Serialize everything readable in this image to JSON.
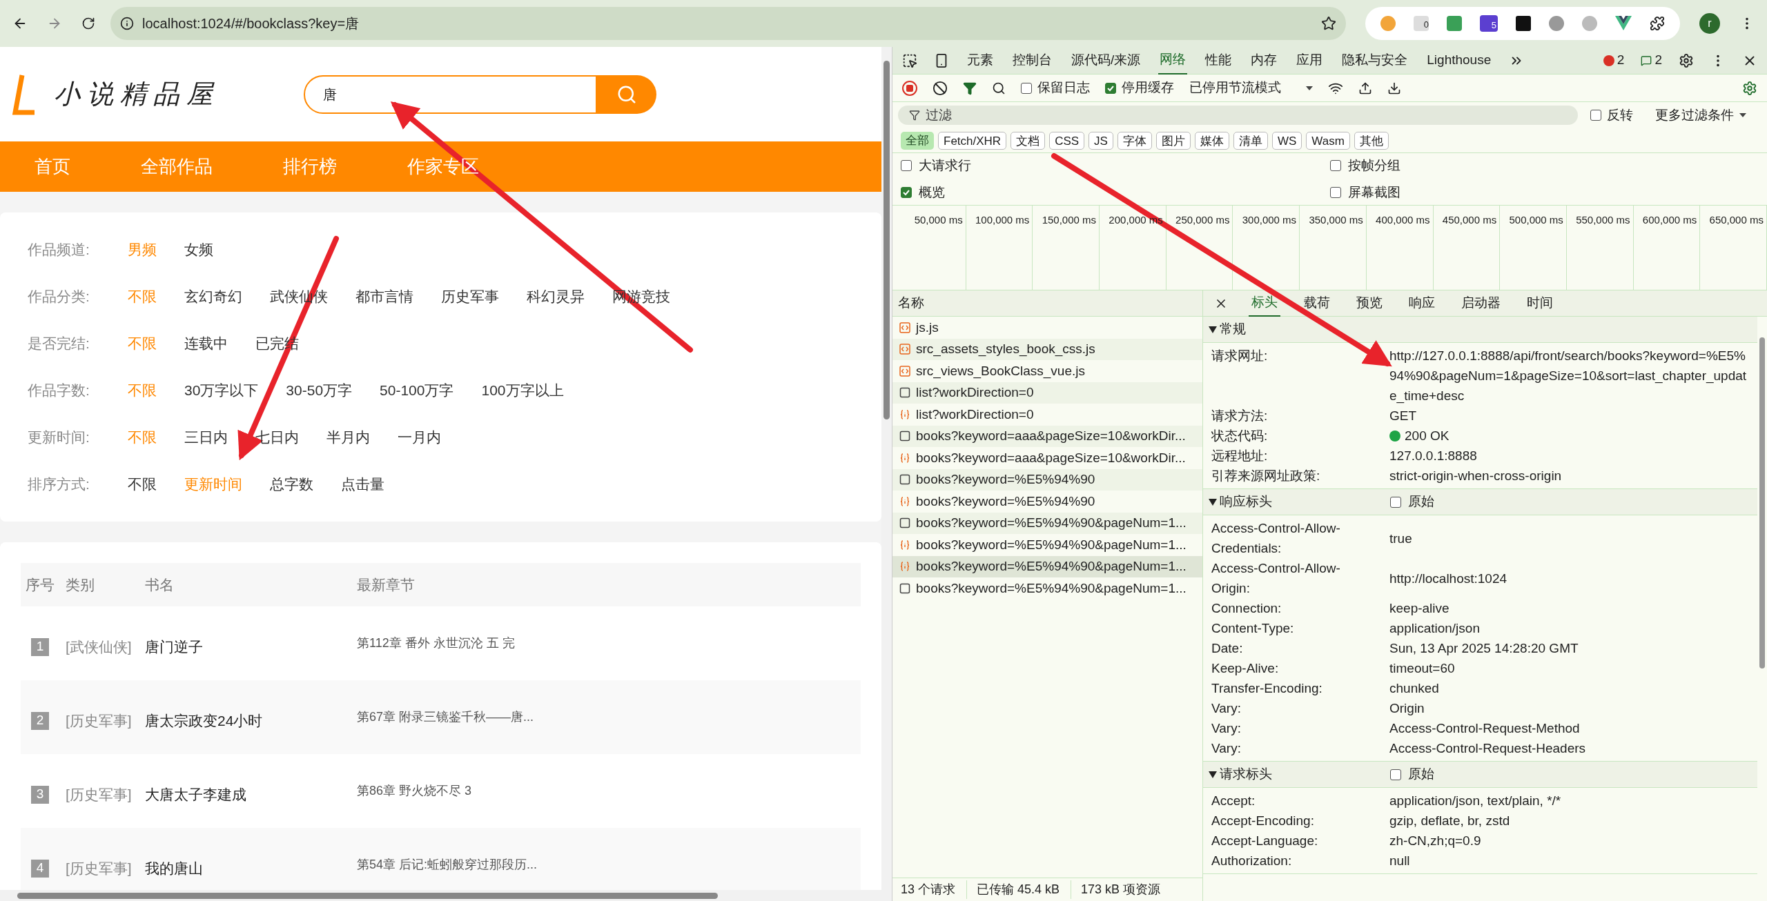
{
  "browser": {
    "url": "localhost:1024/#/bookclass?key=唐",
    "badges": [
      "0",
      "5"
    ],
    "avatar": "r"
  },
  "site": {
    "logo": "小说精品屋",
    "search": {
      "value": "唐"
    },
    "nav": [
      "首页",
      "全部作品",
      "排行榜",
      "作家专区"
    ],
    "filters": [
      {
        "label": "作品频道:",
        "options": [
          {
            "text": "男频",
            "selected": true
          },
          {
            "text": "女频",
            "selected": false
          }
        ]
      },
      {
        "label": "作品分类:",
        "options": [
          {
            "text": "不限",
            "selected": true
          },
          {
            "text": "玄幻奇幻",
            "selected": false
          },
          {
            "text": "武侠仙侠",
            "selected": false
          },
          {
            "text": "都市言情",
            "selected": false
          },
          {
            "text": "历史军事",
            "selected": false
          },
          {
            "text": "科幻灵异",
            "selected": false
          },
          {
            "text": "网游竞技",
            "selected": false
          }
        ]
      },
      {
        "label": "是否完结:",
        "options": [
          {
            "text": "不限",
            "selected": true
          },
          {
            "text": "连载中",
            "selected": false
          },
          {
            "text": "已完结",
            "selected": false
          }
        ]
      },
      {
        "label": "作品字数:",
        "options": [
          {
            "text": "不限",
            "selected": true
          },
          {
            "text": "30万字以下",
            "selected": false
          },
          {
            "text": "30-50万字",
            "selected": false
          },
          {
            "text": "50-100万字",
            "selected": false
          },
          {
            "text": "100万字以上",
            "selected": false
          }
        ]
      },
      {
        "label": "更新时间:",
        "options": [
          {
            "text": "不限",
            "selected": true
          },
          {
            "text": "三日内",
            "selected": false
          },
          {
            "text": "七日内",
            "selected": false
          },
          {
            "text": "半月内",
            "selected": false
          },
          {
            "text": "一月内",
            "selected": false
          }
        ]
      },
      {
        "label": "排序方式:",
        "options": [
          {
            "text": "不限",
            "selected": false
          },
          {
            "text": "更新时间",
            "selected": true
          },
          {
            "text": "总字数",
            "selected": false
          },
          {
            "text": "点击量",
            "selected": false
          }
        ]
      }
    ],
    "table": {
      "columns": [
        "序号",
        "类别",
        "书名",
        "最新章节"
      ],
      "rows": [
        {
          "rank": "1",
          "category": "[武侠仙侠]",
          "title": "唐门逆子",
          "chapter": "第112章 番外 永世沉沦 五 完"
        },
        {
          "rank": "2",
          "category": "[历史军事]",
          "title": "唐太宗政变24小时",
          "chapter": "第67章 附录三镜鉴千秋——唐..."
        },
        {
          "rank": "3",
          "category": "[历史军事]",
          "title": "大唐太子李建成",
          "chapter": "第86章 野火烧不尽 3"
        },
        {
          "rank": "4",
          "category": "[历史军事]",
          "title": "我的唐山",
          "chapter": "第54章 后记:蚯蚓般穿过那段历..."
        }
      ]
    }
  },
  "devtools": {
    "tabs": [
      {
        "label": "元素",
        "selected": false
      },
      {
        "label": "控制台",
        "selected": false
      },
      {
        "label": "源代码/来源",
        "selected": false
      },
      {
        "label": "网络",
        "selected": true
      },
      {
        "label": "性能",
        "selected": false
      },
      {
        "label": "内存",
        "selected": false
      },
      {
        "label": "应用",
        "selected": false
      },
      {
        "label": "隐私与安全",
        "selected": false
      },
      {
        "label": "Lighthouse",
        "selected": false
      }
    ],
    "errors": "2",
    "messages": "2",
    "preserve_log": {
      "label": "保留日志",
      "checked": false
    },
    "disable_cache": {
      "label": "停用缓存",
      "checked": true
    },
    "throttle": "已停用节流模式",
    "filter": {
      "placeholder": "过滤",
      "invert": {
        "label": "反转",
        "checked": false
      },
      "more": "更多过滤条件"
    },
    "types": [
      {
        "label": "全部",
        "selected": true
      },
      {
        "label": "Fetch/XHR",
        "selected": false
      },
      {
        "label": "文档",
        "selected": false
      },
      {
        "label": "CSS",
        "selected": false
      },
      {
        "label": "JS",
        "selected": false
      },
      {
        "label": "字体",
        "selected": false
      },
      {
        "label": "图片",
        "selected": false
      },
      {
        "label": "媒体",
        "selected": false
      },
      {
        "label": "清单",
        "selected": false
      },
      {
        "label": "WS",
        "selected": false
      },
      {
        "label": "Wasm",
        "selected": false
      },
      {
        "label": "其他",
        "selected": false
      }
    ],
    "options": [
      {
        "label": "大请求行",
        "checked": false
      },
      {
        "label": "按帧分组",
        "checked": false
      },
      {
        "label": "概览",
        "checked": true
      },
      {
        "label": "屏幕截图",
        "checked": false
      }
    ],
    "ticks": [
      "50,000 ms",
      "100,000 ms",
      "150,000 ms",
      "200,000 ms",
      "250,000 ms",
      "300,000 ms",
      "350,000 ms",
      "400,000 ms",
      "450,000 ms",
      "500,000 ms",
      "550,000 ms",
      "600,000 ms",
      "650,000 ms"
    ],
    "requests": {
      "header": "名称",
      "rows": [
        {
          "name": "js.js",
          "kind": "script",
          "selected": false
        },
        {
          "name": "src_assets_styles_book_css.js",
          "kind": "script",
          "selected": false
        },
        {
          "name": "src_views_BookClass_vue.js",
          "kind": "script",
          "selected": false
        },
        {
          "name": "list?workDirection=0",
          "kind": "preflight",
          "selected": false
        },
        {
          "name": "list?workDirection=0",
          "kind": "fetch",
          "selected": false
        },
        {
          "name": "books?keyword=aaa&pageSize=10&workDir...",
          "kind": "preflight",
          "selected": false
        },
        {
          "name": "books?keyword=aaa&pageSize=10&workDir...",
          "kind": "fetch",
          "selected": false
        },
        {
          "name": "books?keyword=%E5%94%90",
          "kind": "preflight",
          "selected": false
        },
        {
          "name": "books?keyword=%E5%94%90",
          "kind": "fetch",
          "selected": false
        },
        {
          "name": "books?keyword=%E5%94%90&pageNum=1...",
          "kind": "preflight",
          "selected": false
        },
        {
          "name": "books?keyword=%E5%94%90&pageNum=1...",
          "kind": "fetch",
          "selected": false
        },
        {
          "name": "books?keyword=%E5%94%90&pageNum=1...",
          "kind": "fetch",
          "selected": true
        },
        {
          "name": "books?keyword=%E5%94%90&pageNum=1...",
          "kind": "preflight",
          "selected": false
        }
      ]
    },
    "status": [
      "13 个请求",
      "已传输 45.4 kB",
      "173 kB 项资源"
    ],
    "detail_tabs": [
      {
        "label": "标头",
        "selected": true
      },
      {
        "label": "载荷",
        "selected": false
      },
      {
        "label": "预览",
        "selected": false
      },
      {
        "label": "响应",
        "selected": false
      },
      {
        "label": "启动器",
        "selected": false
      },
      {
        "label": "时间",
        "selected": false
      }
    ],
    "sections": [
      {
        "title": "常规",
        "rows": [
          {
            "name": "请求网址:",
            "value": "http://127.0.0.1:8888/api/front/search/books?keyword=%E5%94%90&pageNum=1&pageSize=10&sort=last_chapter_update_time+desc"
          },
          {
            "name": "请求方法:",
            "value": "GET"
          },
          {
            "name": "状态代码:",
            "value": "200 OK",
            "kind": "status"
          },
          {
            "name": "远程地址:",
            "value": "127.0.0.1:8888"
          },
          {
            "name": "引荐来源网址政策:",
            "value": "strict-origin-when-cross-origin"
          }
        ]
      },
      {
        "title": "响应标头",
        "raw": {
          "label": "原始",
          "checked": false
        },
        "rows": [
          {
            "name": "Access-Control-Allow-Credentials:",
            "value": "true"
          },
          {
            "name": "Access-Control-Allow-Origin:",
            "value": "http://localhost:1024"
          },
          {
            "name": "Connection:",
            "value": "keep-alive"
          },
          {
            "name": "Content-Type:",
            "value": "application/json"
          },
          {
            "name": "Date:",
            "value": "Sun, 13 Apr 2025 14:28:20 GMT"
          },
          {
            "name": "Keep-Alive:",
            "value": "timeout=60"
          },
          {
            "name": "Transfer-Encoding:",
            "value": "chunked"
          },
          {
            "name": "Vary:",
            "value": "Origin"
          },
          {
            "name": "Vary:",
            "value": "Access-Control-Request-Method"
          },
          {
            "name": "Vary:",
            "value": "Access-Control-Request-Headers"
          }
        ]
      },
      {
        "title": "请求标头",
        "raw": {
          "label": "原始",
          "checked": false
        },
        "rows": [
          {
            "name": "Accept:",
            "value": "application/json, text/plain, */*"
          },
          {
            "name": "Accept-Encoding:",
            "value": "gzip, deflate, br, zstd"
          },
          {
            "name": "Accept-Language:",
            "value": "zh-CN,zh;q=0.9"
          },
          {
            "name": "Authorization:",
            "value": "null"
          }
        ]
      }
    ]
  }
}
